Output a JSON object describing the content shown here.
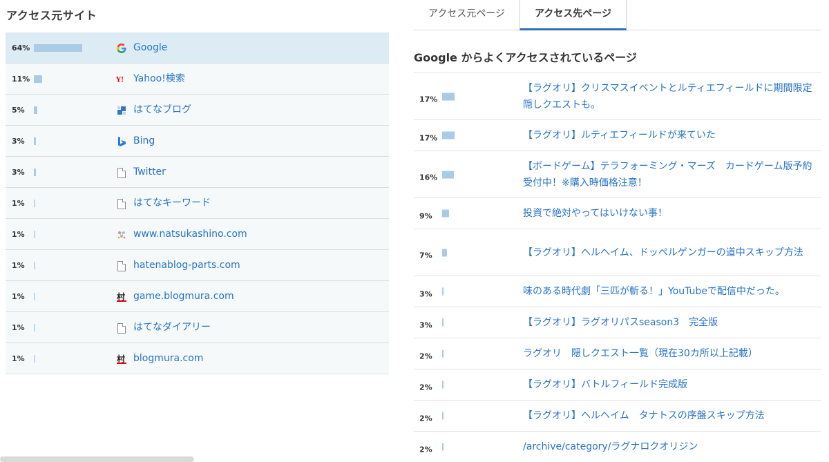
{
  "left": {
    "title": "アクセス元サイト",
    "rows": [
      {
        "pct": "64%",
        "ratio": 0.64,
        "icon": "google-icon",
        "name": "Google",
        "selected": true
      },
      {
        "pct": "11%",
        "ratio": 0.11,
        "icon": "yahoo-icon",
        "name": "Yahoo!検索"
      },
      {
        "pct": "5%",
        "ratio": 0.05,
        "icon": "hatenablog-icon",
        "name": "はてなブログ"
      },
      {
        "pct": "3%",
        "ratio": 0.03,
        "icon": "bing-icon",
        "name": "Bing"
      },
      {
        "pct": "3%",
        "ratio": 0.03,
        "icon": "document-icon",
        "name": "Twitter"
      },
      {
        "pct": "1%",
        "ratio": 0.01,
        "icon": "document-icon",
        "name": "はてなキーワード"
      },
      {
        "pct": "1%",
        "ratio": 0.01,
        "icon": "natsukashino-icon",
        "name": "www.natsukashino.com"
      },
      {
        "pct": "1%",
        "ratio": 0.01,
        "icon": "document-icon",
        "name": "hatenablog-parts.com"
      },
      {
        "pct": "1%",
        "ratio": 0.01,
        "icon": "blogmura-icon",
        "name": "game.blogmura.com"
      },
      {
        "pct": "1%",
        "ratio": 0.01,
        "icon": "document-icon",
        "name": "はてなダイアリー"
      },
      {
        "pct": "1%",
        "ratio": 0.01,
        "icon": "blogmura-icon",
        "name": "blogmura.com"
      }
    ]
  },
  "tabs": {
    "referrer_pages": "アクセス元ページ",
    "destination_pages": "アクセス先ページ",
    "active": "destination_pages"
  },
  "right": {
    "title": "Google からよくアクセスされているページ",
    "rows": [
      {
        "pct": "17%",
        "ratio": 0.17,
        "title": "【ラグオリ】クリスマスイベントとルティエフィールドに期間限定隠しクエストも。",
        "lines": 2
      },
      {
        "pct": "17%",
        "ratio": 0.17,
        "title": "【ラグオリ】ルティエフィールドが来ていた",
        "lines": 1
      },
      {
        "pct": "16%",
        "ratio": 0.16,
        "title": "【ボードゲーム】テラフォーミング・マーズ　カードゲーム版予約受付中！※購入時価格注意！",
        "lines": 2
      },
      {
        "pct": "9%",
        "ratio": 0.09,
        "title": "投資で絶対やってはいけない事！",
        "lines": 1
      },
      {
        "pct": "7%",
        "ratio": 0.07,
        "title": "【ラグオリ】ヘルヘイム、ドッペルゲンガーの道中スキップ方法",
        "lines": 2
      },
      {
        "pct": "3%",
        "ratio": 0.03,
        "title": "味のある時代劇「三匹が斬る！」YouTubeで配信中だった。",
        "lines": 1
      },
      {
        "pct": "3%",
        "ratio": 0.03,
        "title": "【ラグオリ】ラグオリパスseason3　完全版",
        "lines": 1
      },
      {
        "pct": "2%",
        "ratio": 0.02,
        "title": "ラグオリ　隠しクエスト一覧（現在30カ所以上記載）",
        "lines": 1
      },
      {
        "pct": "2%",
        "ratio": 0.02,
        "title": "【ラグオリ】バトルフィールド完成版",
        "lines": 1
      },
      {
        "pct": "2%",
        "ratio": 0.02,
        "title": "【ラグオリ】ヘルヘイム　タナトスの序盤スキップ方法",
        "lines": 1
      },
      {
        "pct": "2%",
        "ratio": 0.02,
        "title": "/archive/category/ラグナロクオリジン",
        "lines": 1
      }
    ]
  },
  "colors": {
    "bar": "#a9cbe5",
    "link": "#2673c5",
    "selected_row": "#ddecf4",
    "tab_underline": "#2a6fb8"
  }
}
